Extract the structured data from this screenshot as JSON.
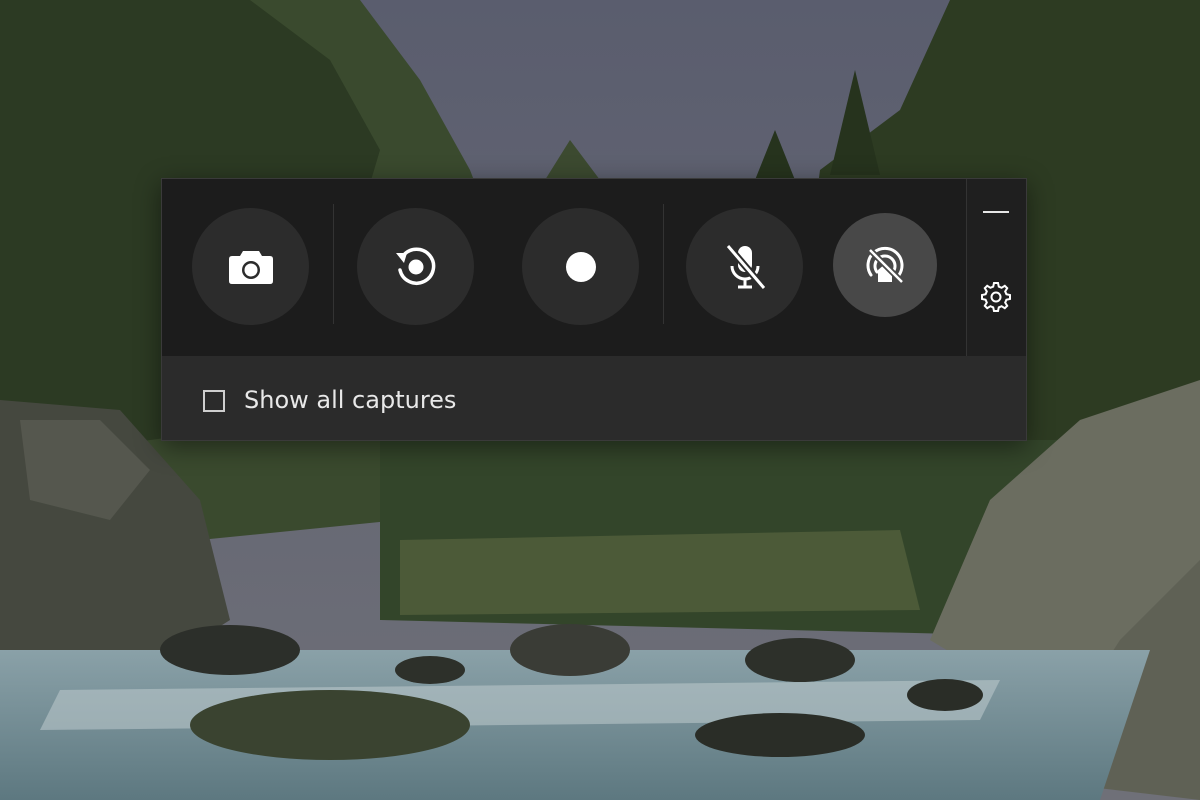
{
  "window": {
    "type": "screen-capture-toolbar"
  },
  "toolbar": {
    "buttons": [
      {
        "id": "screenshot",
        "icon": "camera-icon"
      },
      {
        "id": "record-last",
        "icon": "replay-icon"
      },
      {
        "id": "record",
        "icon": "record-dot-icon"
      },
      {
        "id": "microphone",
        "icon": "mic-off-icon"
      },
      {
        "id": "broadcast",
        "icon": "broadcast-icon",
        "active": true
      }
    ],
    "minimize_icon": "minimize-icon",
    "settings_icon": "gear-icon"
  },
  "footer": {
    "show_all_captures_label": "Show all captures",
    "show_all_captures_checked": false
  },
  "colors": {
    "panel_bg": "#202020",
    "controls_bg": "#1c1c1c",
    "footer_bg": "#2b2b2b",
    "button_bg": "#2c2c2c",
    "button_active_bg": "#484848",
    "icon": "#ffffff"
  }
}
